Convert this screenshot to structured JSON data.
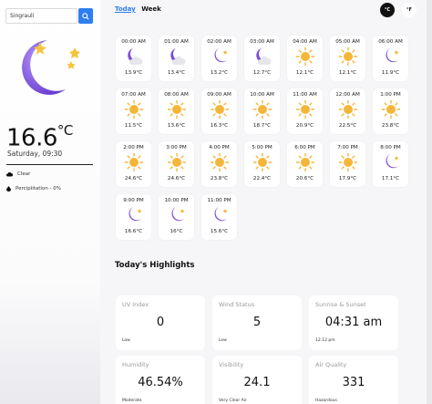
{
  "search": {
    "value": "Singrauli"
  },
  "current": {
    "temp": "16.6",
    "unit": "°C",
    "datetime": "Saturday, 09:30",
    "condition": "Clear",
    "precipitation": "Perciplitation - 0%"
  },
  "tabs": [
    "Today",
    "Week"
  ],
  "units": {
    "c": "°C",
    "f": "°F"
  },
  "hourly": [
    {
      "time": "00:00 AM",
      "temp": "13.9°C",
      "icon": "cloudy-moon-icon"
    },
    {
      "time": "01:00 AM",
      "temp": "13.4°C",
      "icon": "cloudy-moon-icon"
    },
    {
      "time": "02:00 AM",
      "temp": "13.2°C",
      "icon": "moon-icon"
    },
    {
      "time": "03:00 AM",
      "temp": "12.7°C",
      "icon": "cloudy-moon-icon"
    },
    {
      "time": "04:00 AM",
      "temp": "12.1°C",
      "icon": "sun-icon"
    },
    {
      "time": "05:00 AM",
      "temp": "12.1°C",
      "icon": "sun-icon"
    },
    {
      "time": "06:00 AM",
      "temp": "11.9°C",
      "icon": "moon-icon"
    },
    {
      "time": "07:00 AM",
      "temp": "11.5°C",
      "icon": "sun-icon"
    },
    {
      "time": "08:00 AM",
      "temp": "13.6°C",
      "icon": "sun-icon"
    },
    {
      "time": "09:00 AM",
      "temp": "16.3°C",
      "icon": "sun-icon"
    },
    {
      "time": "10:00 AM",
      "temp": "18.7°C",
      "icon": "sun-icon"
    },
    {
      "time": "11:00 AM",
      "temp": "20.9°C",
      "icon": "sun-icon"
    },
    {
      "time": "12:00 AM",
      "temp": "22.5°C",
      "icon": "sun-icon"
    },
    {
      "time": "1:00 PM",
      "temp": "23.8°C",
      "icon": "sun-icon"
    },
    {
      "time": "2:00 PM",
      "temp": "24.6°C",
      "icon": "sun-icon"
    },
    {
      "time": "3:00 PM",
      "temp": "24.6°C",
      "icon": "sun-icon"
    },
    {
      "time": "4:00 PM",
      "temp": "23.8°C",
      "icon": "sun-icon"
    },
    {
      "time": "5:00 PM",
      "temp": "22.4°C",
      "icon": "sun-icon"
    },
    {
      "time": "6:00 PM",
      "temp": "20.6°C",
      "icon": "sun-icon"
    },
    {
      "time": "7:00 PM",
      "temp": "17.9°C",
      "icon": "sun-icon"
    },
    {
      "time": "8:00 PM",
      "temp": "17.1°C",
      "icon": "moon-icon"
    },
    {
      "time": "9:00 PM",
      "temp": "16.6°C",
      "icon": "moon-icon"
    },
    {
      "time": "10:00 PM",
      "temp": "16°C",
      "icon": "moon-icon"
    },
    {
      "time": "11:00 PM",
      "temp": "15.6°C",
      "icon": "moon-icon"
    }
  ],
  "highlights_title": "Today's Highlights",
  "highlights": [
    {
      "title": "UV Index",
      "value": "0",
      "sub": "Low"
    },
    {
      "title": "Wind Status",
      "value": "5",
      "sub": "Low"
    },
    {
      "title": "Sunrise & Sunset",
      "value": "04:31 am",
      "sub": "12:12 pm"
    },
    {
      "title": "Humidity",
      "value": "46.54%",
      "sub": "Moderate"
    },
    {
      "title": "Visibility",
      "value": "24.1",
      "sub": "Very Clear Air"
    },
    {
      "title": "Air Quality",
      "value": "331",
      "sub": "Hazardous"
    }
  ],
  "colors": {
    "accent": "#2f7ef0",
    "moon": "#7b4fd6",
    "sun": "#f4b63a"
  }
}
